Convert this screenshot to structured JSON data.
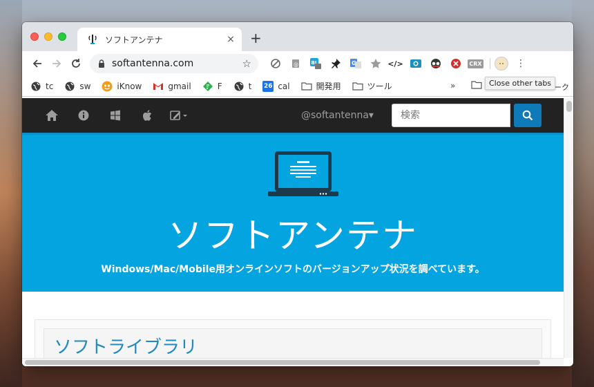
{
  "browser": {
    "tab": {
      "title": "ソフトアンテナ",
      "close": "×"
    },
    "new_tab": "+",
    "address": {
      "url": "softantenna.com"
    },
    "tooltip": "Close other tabs",
    "bookmarks": [
      {
        "label": "tc",
        "icon": "globe-icon"
      },
      {
        "label": "sw",
        "icon": "globe-icon"
      },
      {
        "label": "iKnow",
        "icon": "iknow-icon"
      },
      {
        "label": "gmail",
        "icon": "gmail-icon"
      },
      {
        "label": "F",
        "icon": "feedly-icon"
      },
      {
        "label": "t",
        "icon": "globe-icon"
      },
      {
        "label": "cal",
        "icon": "calendar-icon",
        "badge": "26"
      },
      {
        "label": "開発用",
        "icon": "folder-icon"
      },
      {
        "label": "ツール",
        "icon": "folder-icon"
      }
    ],
    "bookmarks_more": "»",
    "bookmark_last_label": "ーク",
    "extensions": {
      "crx_label": "CRX",
      "code_label": "</>"
    }
  },
  "site": {
    "handle": "@softantenna▾",
    "search_placeholder": "検索",
    "hero_title": "ソフトアンテナ",
    "hero_subtitle": "Windows/Mac/Mobile用オンラインソフトのバージョンアップ状況を調べています。",
    "section_title": "ソフトライブラリ"
  },
  "colors": {
    "hero_blue": "#03a4e0",
    "nav_dark": "#222222",
    "search_button": "#0e7ab8",
    "section_title": "#1f8ac0"
  }
}
